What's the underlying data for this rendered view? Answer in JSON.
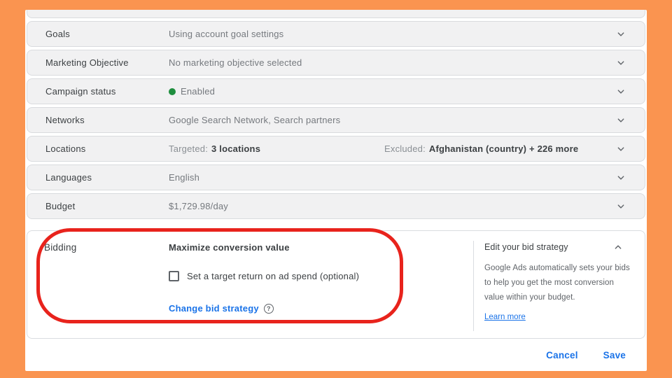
{
  "colors": {
    "background_orange": "#FA9450",
    "accent_blue": "#1A73E8",
    "status_green": "#1E8E3E",
    "annotation_red": "#E8231C",
    "row_gray": "#F1F1F2"
  },
  "rows": [
    {
      "label": "Goals",
      "value": "Using account goal settings"
    },
    {
      "label": "Marketing Objective",
      "value": "No marketing objective selected"
    },
    {
      "label": "Campaign status",
      "value": "Enabled",
      "status": "enabled"
    },
    {
      "label": "Networks",
      "value": "Google Search Network, Search partners"
    },
    {
      "label": "Locations",
      "targeted_prefix": "Targeted:",
      "targeted": "3 locations",
      "excluded_prefix": "Excluded:",
      "excluded": "Afghanistan (country) + 226 more"
    },
    {
      "label": "Languages",
      "value": "English"
    },
    {
      "label": "Budget",
      "value": "$1,729.98/day"
    }
  ],
  "bidding": {
    "label": "Bidding",
    "strategy": "Maximize conversion value",
    "checkbox_label": "Set a target return on ad spend (optional)",
    "checkbox_checked": false,
    "change_bid_link": "Change bid strategy",
    "help_glyph": "?",
    "side_panel": {
      "title": "Edit your bid strategy",
      "body": "Google Ads automatically sets your bids to help you get the most conversion value within your budget.",
      "learn_more_link": "Learn more"
    }
  },
  "footer": {
    "cancel_label": "Cancel",
    "save_label": "Save"
  },
  "annotation": {
    "type": "hand-drawn red rounded-rectangle highlight around Bidding section"
  }
}
